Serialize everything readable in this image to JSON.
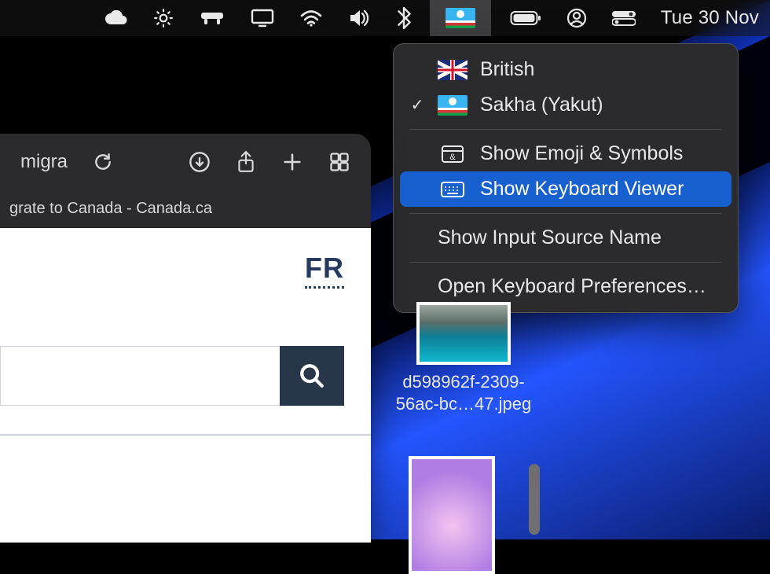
{
  "menubar": {
    "clock": "Tue 30 Nov"
  },
  "dropdown": {
    "lang1": "British",
    "lang2": "Sakha (Yakut)",
    "item_emoji": "Show Emoji & Symbols",
    "item_keyboard_viewer": "Show Keyboard Viewer",
    "item_input_name": "Show Input Source Name",
    "item_prefs": "Open Keyboard Preferences…"
  },
  "browser": {
    "url_fragment": "migra",
    "tab_title": "grate to Canada - Canada.ca",
    "fr_label": "FR",
    "search_placeholder": ""
  },
  "desktop": {
    "file1_name": "d598962f-2309-56ac-bc…47.jpeg"
  }
}
